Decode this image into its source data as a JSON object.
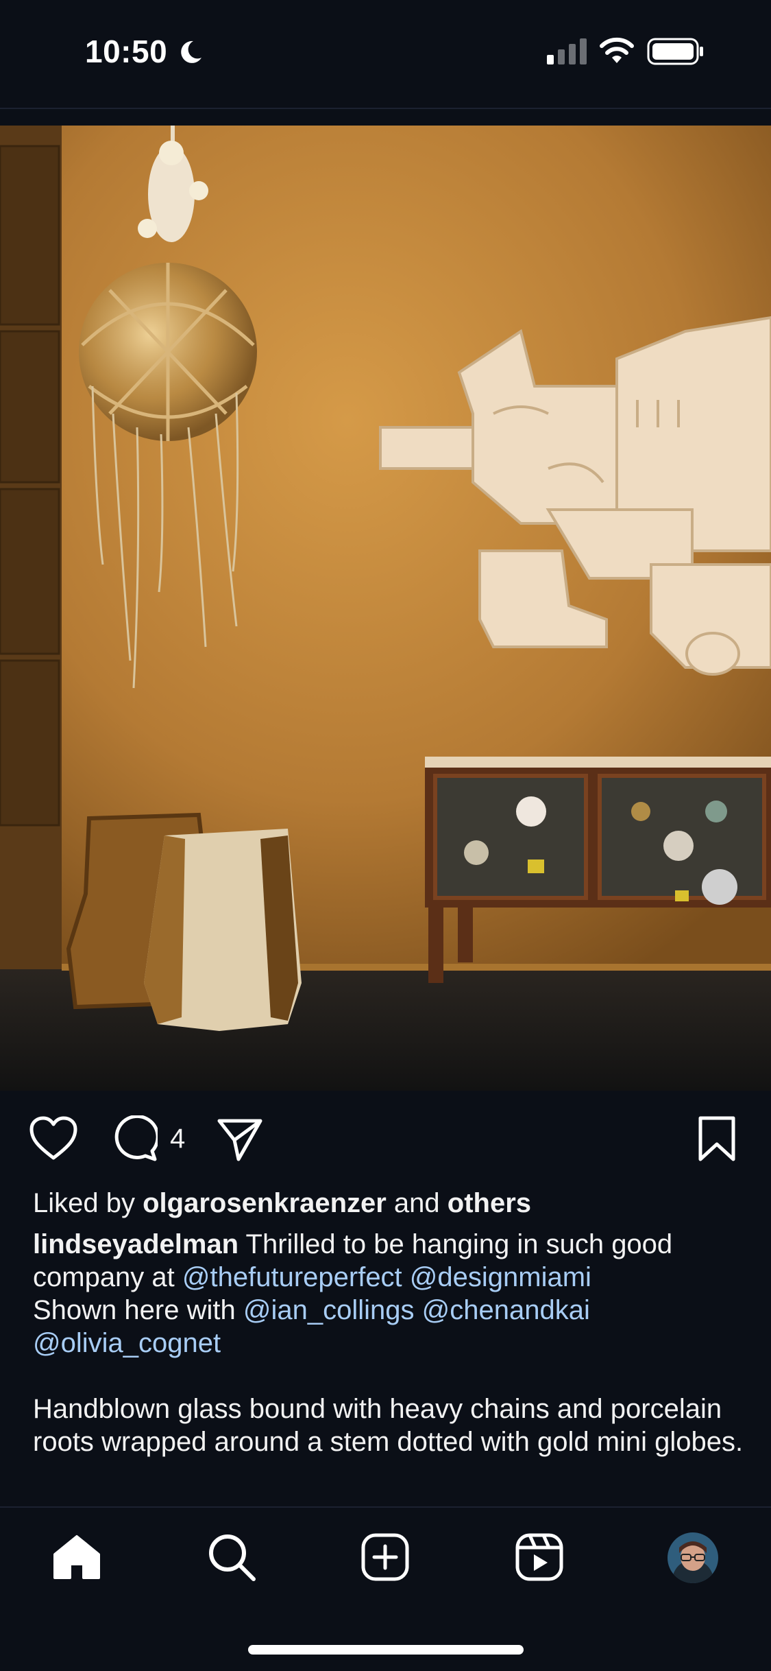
{
  "status_bar": {
    "time": "10:50",
    "icons": [
      "moon-icon",
      "signal-icon",
      "wifi-icon",
      "battery-icon"
    ]
  },
  "post": {
    "image_icon": "post-photo",
    "actions": {
      "like_icon": "heart-icon",
      "comment_icon": "comment-icon",
      "comment_count": "4",
      "share_icon": "paper-plane-icon",
      "save_icon": "bookmark-icon"
    },
    "likes": {
      "prefix": "Liked by ",
      "user": "olgarosenkraenzer",
      "middle": " and ",
      "others": "others"
    },
    "caption": {
      "author": "lindseyadelman",
      "text1": " Thrilled to be hanging in such good company at ",
      "mention1": "@thefutureperfect",
      "mention2": "@designmiami",
      "text2": "Shown here with ",
      "mention3": "@ian_collings",
      "mention4": "@chenandkai",
      "mention5": "@olivia_cognet",
      "paragraph2": "Handblown glass bound with heavy chains and porcelain roots wrapped around a stem dotted with gold mini globes."
    }
  },
  "bottom_nav": {
    "items": [
      "home-icon",
      "search-icon",
      "create-icon",
      "reels-icon",
      "profile-avatar"
    ]
  },
  "colors": {
    "background": "#0b0f17",
    "text": "#f2f2f2",
    "mention": "#a8cdf5",
    "wall": "#c08a3e"
  }
}
